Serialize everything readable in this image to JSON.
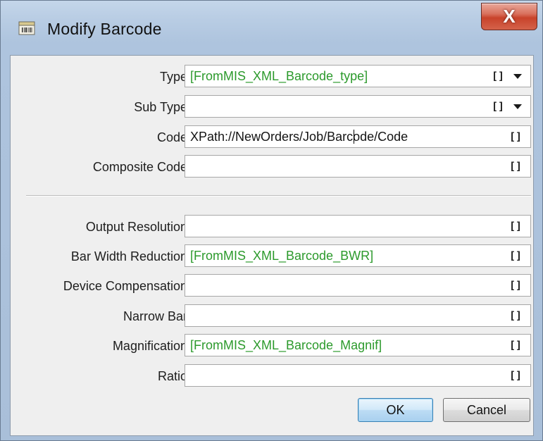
{
  "window": {
    "title": "Modify Barcode",
    "close_glyph": "X",
    "icon": "barcode-document-icon"
  },
  "fields": [
    {
      "label": "Type:",
      "value": "[FromMIS_XML_Barcode_type]",
      "value_color": "green",
      "dropdown": true
    },
    {
      "label": "Sub Type:",
      "value": "",
      "value_color": "black",
      "dropdown": true
    },
    {
      "label": "Code:",
      "value": "XPath://NewOrders/Job/Barcode/Code",
      "value_color": "black",
      "dropdown": false,
      "focused": true
    },
    {
      "label": "Composite Code:",
      "value": "",
      "value_color": "black",
      "dropdown": false
    },
    {
      "label": "Output Resolution:",
      "value": "",
      "value_color": "black",
      "dropdown": false
    },
    {
      "label": "Bar Width Reduction:",
      "value": "[FromMIS_XML_Barcode_BWR]",
      "value_color": "green",
      "dropdown": false
    },
    {
      "label": "Device Compensation:",
      "value": "",
      "value_color": "black",
      "dropdown": false
    },
    {
      "label": "Narrow Bar:",
      "value": "",
      "value_color": "black",
      "dropdown": false
    },
    {
      "label": "Magnification:",
      "value": "[FromMIS_XML_Barcode_Magnif]",
      "value_color": "green",
      "dropdown": false
    },
    {
      "label": "Ratio:",
      "value": "",
      "value_color": "black",
      "dropdown": false
    }
  ],
  "variable_button_glyph": "[]",
  "buttons": {
    "ok": "OK",
    "cancel": "Cancel"
  },
  "colors": {
    "variable_text": "#2c9a2c",
    "close_button": "#c8432b",
    "default_button_border": "#3c7fb1"
  }
}
